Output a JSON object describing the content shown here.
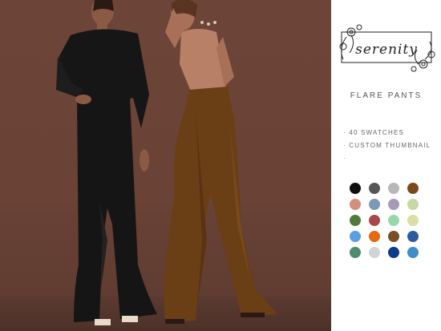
{
  "brand": {
    "logo_text": "serenity"
  },
  "product": {
    "title": "FLARE PANTS"
  },
  "features": [
    "40 SWATCHES",
    "CUSTOM THUMBNAIL",
    ""
  ],
  "swatches": [
    "#0f0f0f",
    "#565656",
    "#b7b7b7",
    "#7a4a1c",
    "#d48f7c",
    "#7b9bb3",
    "#a69ab7",
    "#c8d8a2",
    "#4f7a3c",
    "#a9484a",
    "#98d7ac",
    "#dcdca4",
    "#5a9fe0",
    "#e36b0d",
    "#7b4f22",
    "#2e5aa0",
    "#4f8b6e",
    "#cfd4d8",
    "#0c3b8c",
    "#3f8ec6"
  ],
  "colors": {
    "backdrop": "#6d4438",
    "panel": "#ffffff"
  },
  "scene": {
    "description_icon": "two-models-photo"
  }
}
